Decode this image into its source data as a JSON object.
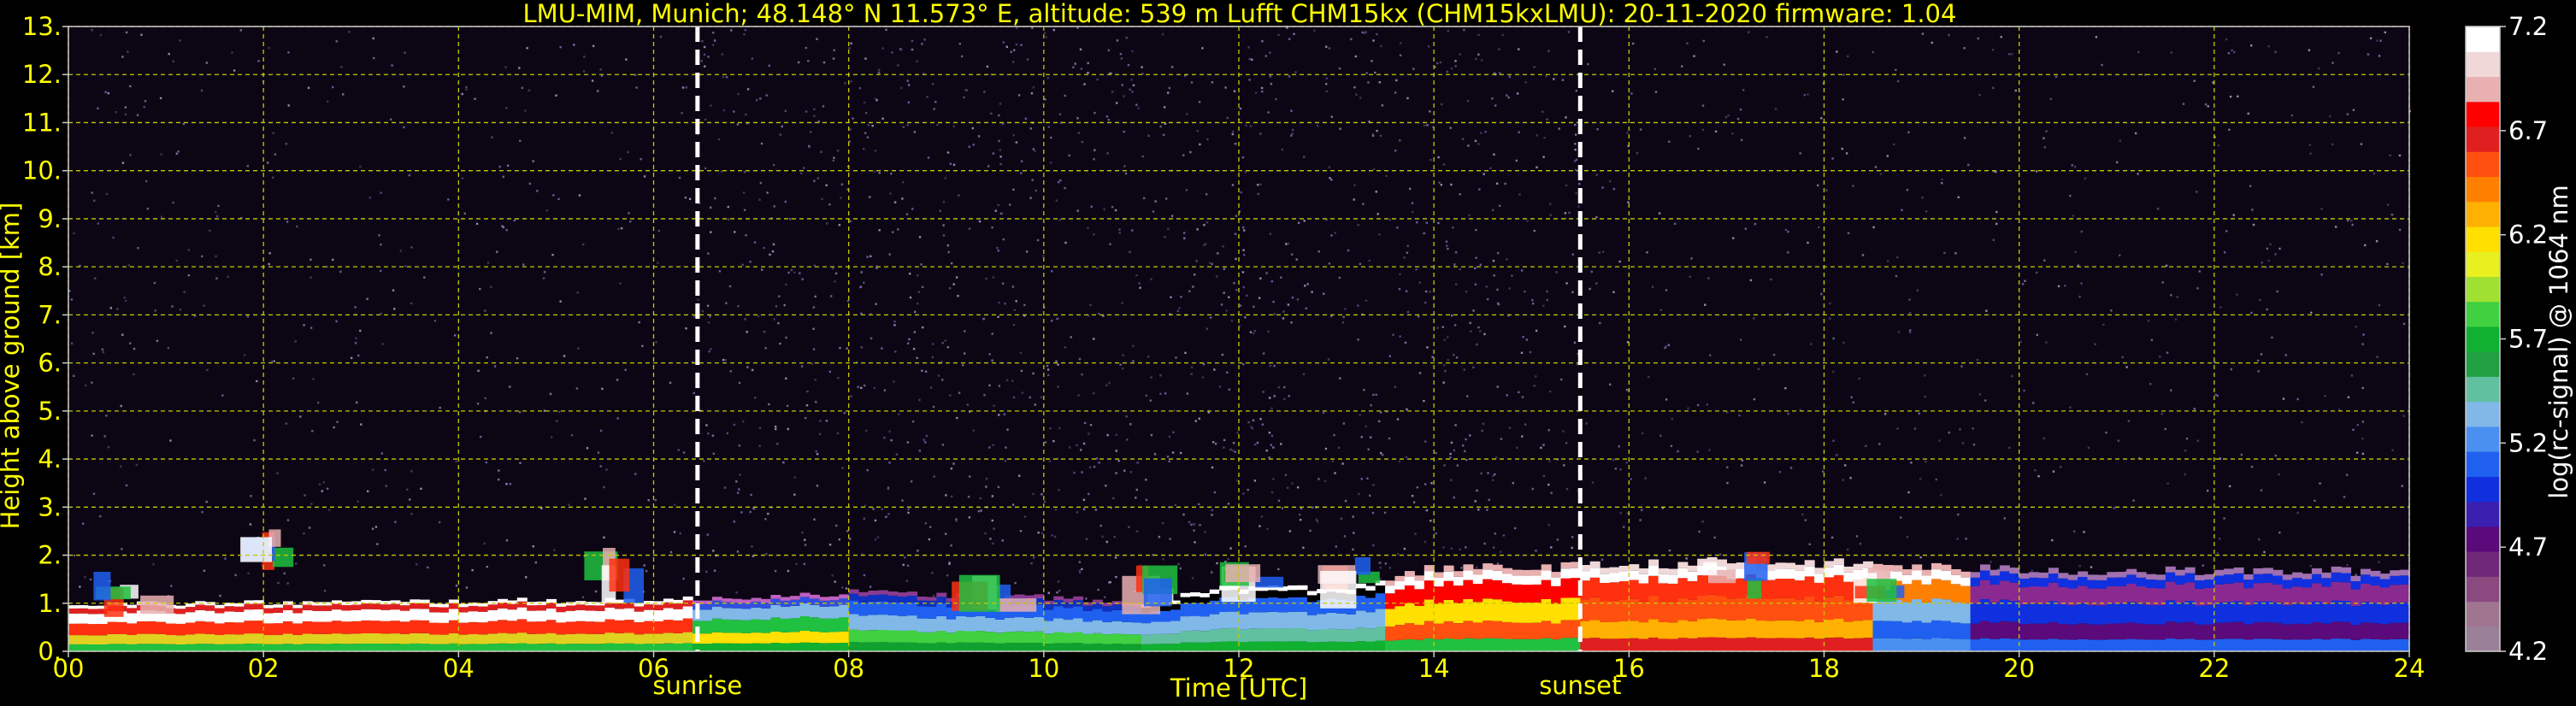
{
  "chart_data": {
    "type": "heatmap",
    "title": "LMU-MIM, Munich; 48.148° N 11.573° E, altitude: 539 m    Lufft CHM15kx (CHM15kxLMU): 20-11-2020    firmware: 1.04",
    "xlabel": "Time [UTC]",
    "ylabel": "Height above ground [km]",
    "xlim": [
      0,
      24
    ],
    "ylim": [
      0,
      13
    ],
    "x_ticks": [
      "00",
      "02",
      "04",
      "06",
      "08",
      "10",
      "12",
      "14",
      "16",
      "18",
      "20",
      "22",
      "24"
    ],
    "y_ticks": [
      "0.",
      "1.",
      "2.",
      "3.",
      "4.",
      "5.",
      "6.",
      "7.",
      "8.",
      "9.",
      "10.",
      "11.",
      "12.",
      "13."
    ],
    "grid": true,
    "annotations": [
      {
        "label": "sunrise",
        "x": 6.45
      },
      {
        "label": "sunset",
        "x": 15.5
      }
    ],
    "colorbar": {
      "label": "log(rc-signal) @ 1064 nm",
      "min": 4.2,
      "max": 7.2,
      "ticks": [
        "4.2",
        "4.7",
        "5.2",
        "5.7",
        "6.2",
        "6.7",
        "7.2"
      ],
      "colors": [
        "#9a8098",
        "#a07590",
        "#8a4a80",
        "#702878",
        "#5a0a7a",
        "#3a20b0",
        "#1030e0",
        "#2060f0",
        "#4a90f0",
        "#80b8e8",
        "#60c0a0",
        "#20a040",
        "#10b030",
        "#40d040",
        "#a0e030",
        "#e8f020",
        "#ffe000",
        "#ffb000",
        "#ff8000",
        "#ff5010",
        "#e02020",
        "#ff0000",
        "#e8b0b0",
        "#f0d8d8",
        "#ffffff"
      ]
    },
    "layers": [
      {
        "name": "boundary layer top",
        "x": [
          0,
          6.45,
          8,
          10,
          11,
          12,
          13,
          14,
          15.5,
          17,
          18.5,
          19.5,
          21,
          24
        ],
        "y": [
          1.0,
          1.1,
          1.25,
          1.15,
          1.0,
          1.4,
          1.3,
          1.75,
          1.8,
          1.9,
          1.85,
          1.75,
          1.7,
          1.7
        ]
      },
      {
        "name": "cloud signal",
        "x": [
          0.5,
          2.0,
          5.5,
          9.3,
          11.0,
          12.0,
          13.0,
          17.0,
          18.5
        ],
        "y": [
          1.7,
          2.6,
          2.2,
          1.6,
          1.8,
          1.9,
          2.2,
          2.1,
          1.8
        ]
      }
    ]
  }
}
